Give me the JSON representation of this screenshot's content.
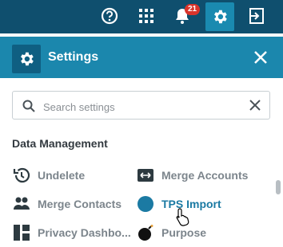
{
  "topbar": {
    "icons": [
      "help-icon",
      "apps-grid-icon",
      "bell-icon",
      "gear-icon",
      "logout-icon"
    ],
    "notification_count": "21"
  },
  "panel": {
    "title": "Settings",
    "icon": "gear-icon",
    "close_icon": "close-icon"
  },
  "search": {
    "placeholder": "Search settings",
    "value": ""
  },
  "section": {
    "title": "Data Management"
  },
  "items": [
    {
      "label": "Undelete",
      "icon": "history-icon"
    },
    {
      "label": "Merge Accounts",
      "icon": "merge-accounts-icon"
    },
    {
      "label": "Merge Contacts",
      "icon": "people-icon"
    },
    {
      "label": "TPS Import",
      "icon": "circle-icon",
      "color": "#1b7aa3"
    },
    {
      "label": "Privacy Dashbo...",
      "icon": "dashboard-icon"
    },
    {
      "label": "Purpose",
      "icon": "bomb-icon"
    }
  ],
  "colors": {
    "topbar": "#0f4f6e",
    "header": "#1b87ad",
    "accent": "#1b7aa3",
    "badge": "#d9342b"
  }
}
